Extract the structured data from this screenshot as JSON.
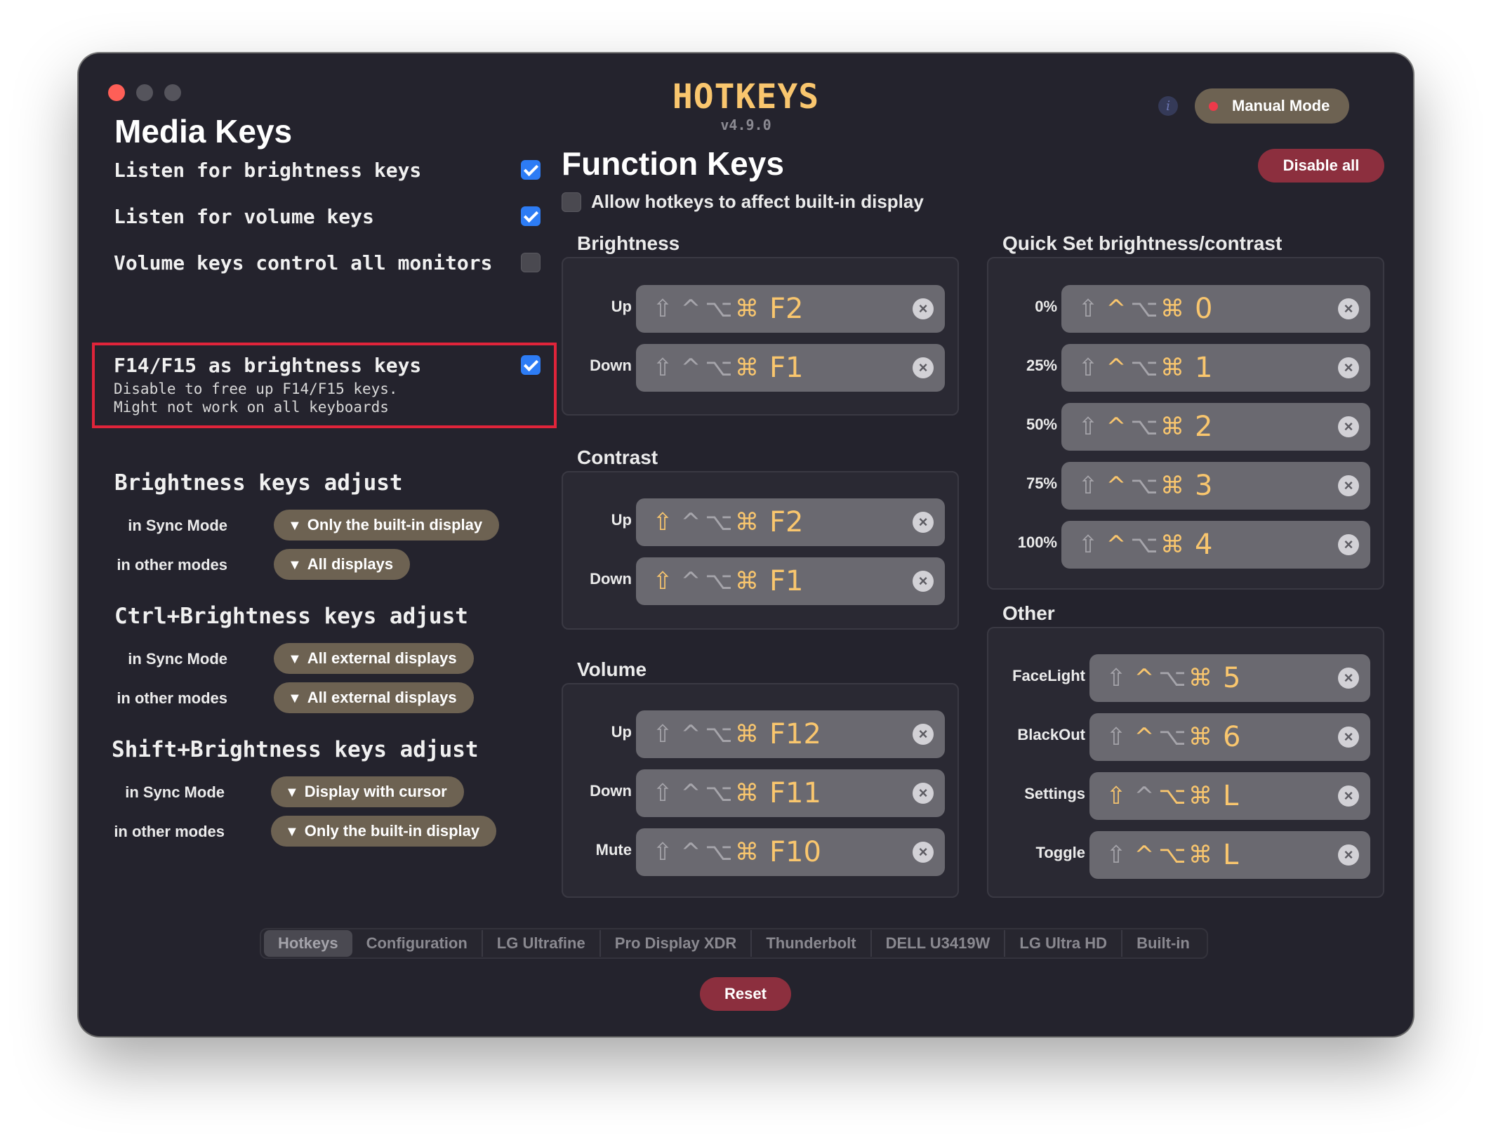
{
  "app": {
    "title": "HOTKEYS",
    "version": "v4.9.0"
  },
  "header": {
    "info_icon": "i",
    "mode_label": "Manual Mode",
    "mode_dot_color": "#ee3a4a"
  },
  "media_keys": {
    "title": "Media Keys",
    "options": [
      {
        "label": "Listen for brightness keys",
        "checked": true
      },
      {
        "label": "Listen for volume keys",
        "checked": true
      },
      {
        "label": "Volume keys control all monitors",
        "checked": false
      }
    ],
    "f14": {
      "label": "F14/F15 as brightness keys",
      "desc_line1": "Disable to free up F14/F15 keys.",
      "desc_line2": "Might not work on all keyboards",
      "checked": true
    }
  },
  "brightness_adjust": {
    "title": "Brightness keys adjust",
    "sync_label": "in Sync Mode",
    "sync_value": "Only the built-in display",
    "other_label": "in other modes",
    "other_value": "All displays"
  },
  "ctrl_adjust": {
    "title": "Ctrl+Brightness keys adjust",
    "sync_label": "in Sync Mode",
    "sync_value": "All external displays",
    "other_label": "in other modes",
    "other_value": "All external displays"
  },
  "shift_adjust": {
    "title": "Shift+Brightness keys adjust",
    "sync_label": "in Sync Mode",
    "sync_value": "Display with cursor",
    "other_label": "in other modes",
    "other_value": "Only the built-in display"
  },
  "dropdown_arrow": "▼",
  "function_keys": {
    "title": "Function Keys",
    "disable_all": "Disable all",
    "allow_builtin": "Allow hotkeys to affect built-in display",
    "allow_builtin_checked": false
  },
  "modifiers": {
    "shift": "⇧",
    "ctrl": "^",
    "opt": "⌥",
    "cmd": "⌘"
  },
  "clear_glyph": "×",
  "brightness": {
    "title": "Brightness",
    "up_label": "Up",
    "up_key": "F2",
    "down_label": "Down",
    "down_key": "F1"
  },
  "contrast": {
    "title": "Contrast",
    "up_label": "Up",
    "up_key": "F2",
    "down_label": "Down",
    "down_key": "F1"
  },
  "volume": {
    "title": "Volume",
    "up_label": "Up",
    "up_key": "F12",
    "down_label": "Down",
    "down_key": "F11",
    "mute_label": "Mute",
    "mute_key": "F10"
  },
  "quick_set": {
    "title": "Quick Set brightness/contrast",
    "rows": [
      {
        "label": "0%",
        "key": "0"
      },
      {
        "label": "25%",
        "key": "1"
      },
      {
        "label": "50%",
        "key": "2"
      },
      {
        "label": "75%",
        "key": "3"
      },
      {
        "label": "100%",
        "key": "4"
      }
    ]
  },
  "other": {
    "title": "Other",
    "rows": [
      {
        "label": "FaceLight",
        "key": "5"
      },
      {
        "label": "BlackOut",
        "key": "6"
      },
      {
        "label": "Settings",
        "key": "L"
      },
      {
        "label": "Toggle",
        "key": "L"
      }
    ]
  },
  "tabs": [
    "Hotkeys",
    "Configuration",
    "LG Ultrafine",
    "Pro Display XDR",
    "Thunderbolt",
    "DELL U3419W",
    "LG Ultra HD",
    "Built-in"
  ],
  "selected_tab": "Hotkeys",
  "reset_label": "Reset",
  "colors": {
    "accent_yellow": "#f9c66e",
    "danger": "#8c2f3e",
    "pill": "#6d6252",
    "checkbox": "#2d7cf5",
    "background": "#24232d"
  }
}
